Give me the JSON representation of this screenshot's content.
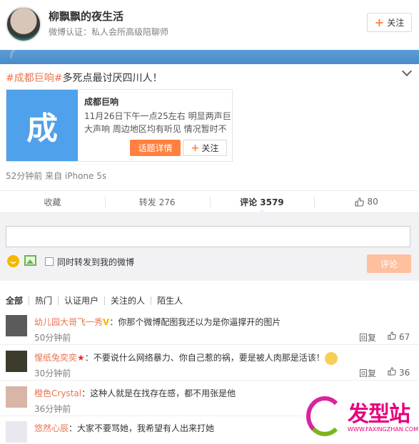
{
  "user": {
    "name": "柳飘飘的夜生活",
    "verify": "微博认证：私人会所高级陪聊师",
    "follow_label": "关注"
  },
  "post": {
    "tag": "#成都巨响#",
    "text": "多死点最讨厌四川人！",
    "meta": "52分钟前 来自 iPhone 5s"
  },
  "topic_card": {
    "image_char": "成",
    "title": "成都巨响",
    "desc": "11月26日下午一点25左右 明显两声巨大声响 周边地区均有听见 情况暂时不",
    "detail_label": "话题详情",
    "follow_label": "关注"
  },
  "actions": {
    "favorite": "收藏",
    "repost": "转发 276",
    "comment": "评论 3579",
    "like": "80"
  },
  "composer": {
    "placeholder": "",
    "repost_label": "同时转发到我的微博",
    "submit_label": "评论"
  },
  "filters": [
    "全部",
    "热门",
    "认证用户",
    "关注的人",
    "陌生人"
  ],
  "comments": [
    {
      "name": "幼儿园大哥飞一秀",
      "text": "：你那个微博配图我还以为是你逼撑开的图片",
      "time": "50分钟前",
      "reply": "回复",
      "likes": "67"
    },
    {
      "name": "惺纸兔奕奕",
      "text": "：不要说什么网络暴力、你自己惹的祸，要是被人肉那是活该！",
      "time": "30分钟前",
      "reply": "回复",
      "likes": "36"
    },
    {
      "name": "橙色Crystal",
      "text": "：这种人就是在找存在感，都不用张是他",
      "time": "36分钟前",
      "reply": "",
      "likes": ""
    },
    {
      "name": "悠然心辰",
      "text": "：大家不要骂她，我希望有人出来打她",
      "time": "",
      "reply": "",
      "likes": ""
    }
  ],
  "watermark": {
    "text": "发型站",
    "url": "WWW.FAXINGZHAN.COM"
  },
  "colors": {
    "accent": "#eb7350",
    "orange_btn": "#ff8140",
    "banner": "#5d9cd6"
  }
}
